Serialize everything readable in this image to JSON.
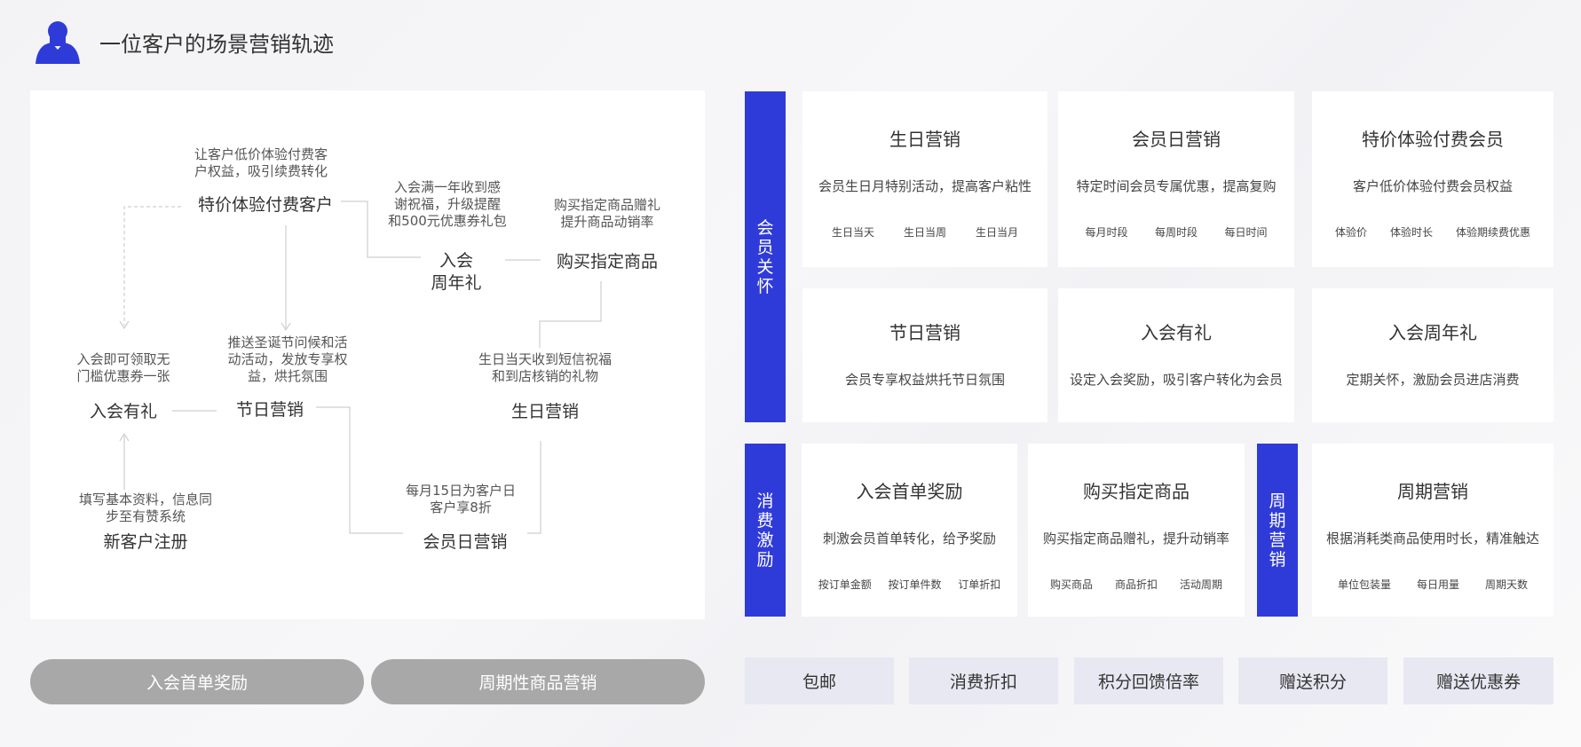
{
  "header": {
    "title": "一位客户的场景营销轨迹"
  },
  "journey": {
    "descs": {
      "trial": "让客户低价体验付费客\n户权益，吸引续费转化",
      "anniversary": "入会满一年收到感\n谢祝福，升级提醒\n和500元优惠券礼包",
      "buy": "购买指定商品赠礼\n提升商品动销率",
      "join": "入会即可领取无\n门槛优惠券一张",
      "holiday": "推送圣诞节问候和活\n动活动，发放专享权\n益，烘托氛围",
      "birthday": "生日当天收到短信祝福\n和到店核销的礼物",
      "register": "填写基本资料，信息同\n步至有赞系统",
      "memberday": "每月15日为客户日\n客户享8折"
    },
    "nodes": {
      "trial": "特价体验付费客户",
      "anniversary": "入会\n周年礼",
      "buy": "购买指定商品",
      "join": "入会有礼",
      "holiday": "节日营销",
      "birthday": "生日营销",
      "register": "新客户注册",
      "memberday": "会员日营销"
    }
  },
  "pills": [
    "入会首单奖励",
    "周期性商品营销"
  ],
  "bars": {
    "care": "会员关怀",
    "consume": "消费激励",
    "cycle": "周期营销"
  },
  "cards": [
    {
      "title": "生日营销",
      "desc": "会员生日月特别活动，提高客户粘性",
      "tags": [
        "生日当天",
        "生日当周",
        "生日当月"
      ]
    },
    {
      "title": "会员日营销",
      "desc": "特定时间会员专属优惠，提高复购",
      "tags": [
        "每月时段",
        "每周时段",
        "每日时间"
      ]
    },
    {
      "title": "特价体验付费会员",
      "desc": "客户低价体验付费会员权益",
      "tags": [
        "体验价",
        "体验时长",
        "体验期续费优惠"
      ]
    },
    {
      "title": "节日营销",
      "desc": "会员专享权益烘托节日氛围",
      "tags": []
    },
    {
      "title": "入会有礼",
      "desc": "设定入会奖励，吸引客户转化为会员",
      "tags": []
    },
    {
      "title": "入会周年礼",
      "desc": "定期关怀，激励会员进店消费",
      "tags": []
    },
    {
      "title": "入会首单奖励",
      "desc": "刺激会员首单转化，给予奖励",
      "tags": [
        "按订单金额",
        "按订单件数",
        "订单折扣"
      ]
    },
    {
      "title": "购买指定商品",
      "desc": "购买指定商品赠礼，提升动销率",
      "tags": [
        "购买商品",
        "商品折扣",
        "活动周期"
      ]
    },
    {
      "title": "周期营销",
      "desc": "根据消耗类商品使用时长，精准触达",
      "tags": [
        "单位包装量",
        "每日用量",
        "周期天数"
      ]
    }
  ],
  "buttons": [
    "包邮",
    "消费折扣",
    "积分回馈倍率",
    "赠送积分",
    "赠送优惠券"
  ],
  "colors": {
    "accent": "#2f3bd9",
    "pill": "#a8a8a8",
    "button_bg": "#e8e8f2"
  }
}
